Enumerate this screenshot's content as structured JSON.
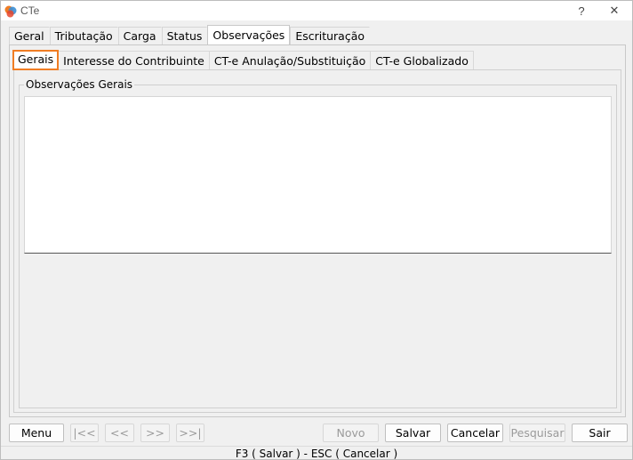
{
  "window": {
    "title": "CTe",
    "help_label": "?",
    "close_label": "✕"
  },
  "tabs": [
    {
      "label": "Geral"
    },
    {
      "label": "Tributação"
    },
    {
      "label": "Carga"
    },
    {
      "label": "Status"
    },
    {
      "label": "Observações"
    },
    {
      "label": "Escrituração"
    }
  ],
  "active_tab": "Observações",
  "subtabs": [
    {
      "label": "Gerais"
    },
    {
      "label": "Interesse do Contribuinte"
    },
    {
      "label": "CT-e Anulação/Substituição"
    },
    {
      "label": "CT-e Globalizado"
    }
  ],
  "active_subtab": "Gerais",
  "observacoes": {
    "group_title": "Observações Gerais",
    "text": ""
  },
  "buttons": {
    "menu": "Menu",
    "first": "|<<",
    "prev": "<<",
    "next": ">>",
    "last": ">>|",
    "novo": "Novo",
    "salvar": "Salvar",
    "cancelar": "Cancelar",
    "pesquisar": "Pesquisar",
    "sair": "Sair"
  },
  "status_bar": {
    "text": "F3 ( Salvar )   -   ESC ( Cancelar )"
  },
  "colors": {
    "accent": "#f07d24",
    "background": "#f0f0f0"
  }
}
